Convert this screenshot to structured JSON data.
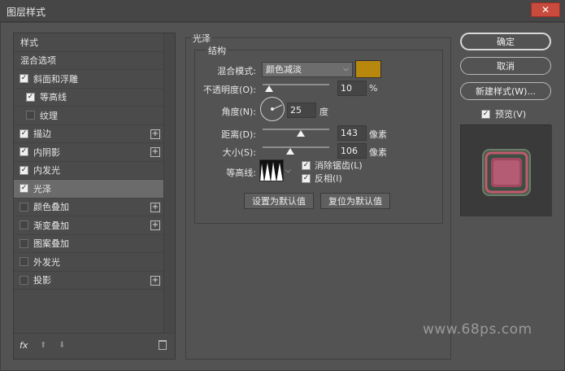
{
  "window": {
    "title": "图层样式",
    "close_glyph": "✕"
  },
  "left_panel": {
    "items": [
      {
        "label": "样式",
        "kind": "header",
        "checked": null,
        "plus": false,
        "selected": false
      },
      {
        "label": "混合选项",
        "kind": "header",
        "checked": null,
        "plus": false,
        "selected": false
      },
      {
        "label": "斜面和浮雕",
        "kind": "item",
        "checked": true,
        "plus": false,
        "selected": false
      },
      {
        "label": "等高线",
        "kind": "sub",
        "checked": true,
        "plus": false,
        "selected": false
      },
      {
        "label": "纹理",
        "kind": "sub",
        "checked": false,
        "plus": false,
        "selected": false
      },
      {
        "label": "描边",
        "kind": "item",
        "checked": true,
        "plus": true,
        "selected": false
      },
      {
        "label": "内阴影",
        "kind": "item",
        "checked": true,
        "plus": true,
        "selected": false
      },
      {
        "label": "内发光",
        "kind": "item",
        "checked": true,
        "plus": false,
        "selected": false
      },
      {
        "label": "光泽",
        "kind": "item",
        "checked": true,
        "plus": false,
        "selected": true
      },
      {
        "label": "颜色叠加",
        "kind": "item",
        "checked": false,
        "plus": true,
        "selected": false
      },
      {
        "label": "渐变叠加",
        "kind": "item",
        "checked": false,
        "plus": true,
        "selected": false
      },
      {
        "label": "图案叠加",
        "kind": "item",
        "checked": false,
        "plus": false,
        "selected": false
      },
      {
        "label": "外发光",
        "kind": "item",
        "checked": false,
        "plus": false,
        "selected": false
      },
      {
        "label": "投影",
        "kind": "item",
        "checked": false,
        "plus": true,
        "selected": false
      }
    ],
    "bottom": {
      "fx_label": "fx",
      "up_glyph": "⬆",
      "down_glyph": "⬇"
    }
  },
  "satin": {
    "section_title": "光泽",
    "group_title": "结构",
    "blend_mode": {
      "label": "混合模式:",
      "value": "颜色减淡",
      "color": "#b8870e"
    },
    "opacity": {
      "label": "不透明度(O):",
      "value": "10",
      "unit": "%",
      "fraction": 0.1
    },
    "angle": {
      "label": "角度(N):",
      "value": "25",
      "unit": "度"
    },
    "distance": {
      "label": "距离(D):",
      "value": "143",
      "unit": "像素",
      "fraction": 0.57
    },
    "size": {
      "label": "大小(S):",
      "value": "106",
      "unit": "像素",
      "fraction": 0.42
    },
    "contour": {
      "label": "等高线:"
    },
    "anti_alias": {
      "label": "消除锯齿(L)",
      "checked": true
    },
    "invert": {
      "label": "反相(I)",
      "checked": true
    },
    "make_default": "设置为默认值",
    "reset_default": "复位为默认值"
  },
  "right": {
    "ok": "确定",
    "cancel": "取消",
    "new_style": "新建样式(W)...",
    "preview": {
      "label": "预览(V)",
      "checked": true
    }
  },
  "watermark": "www.68ps.com"
}
